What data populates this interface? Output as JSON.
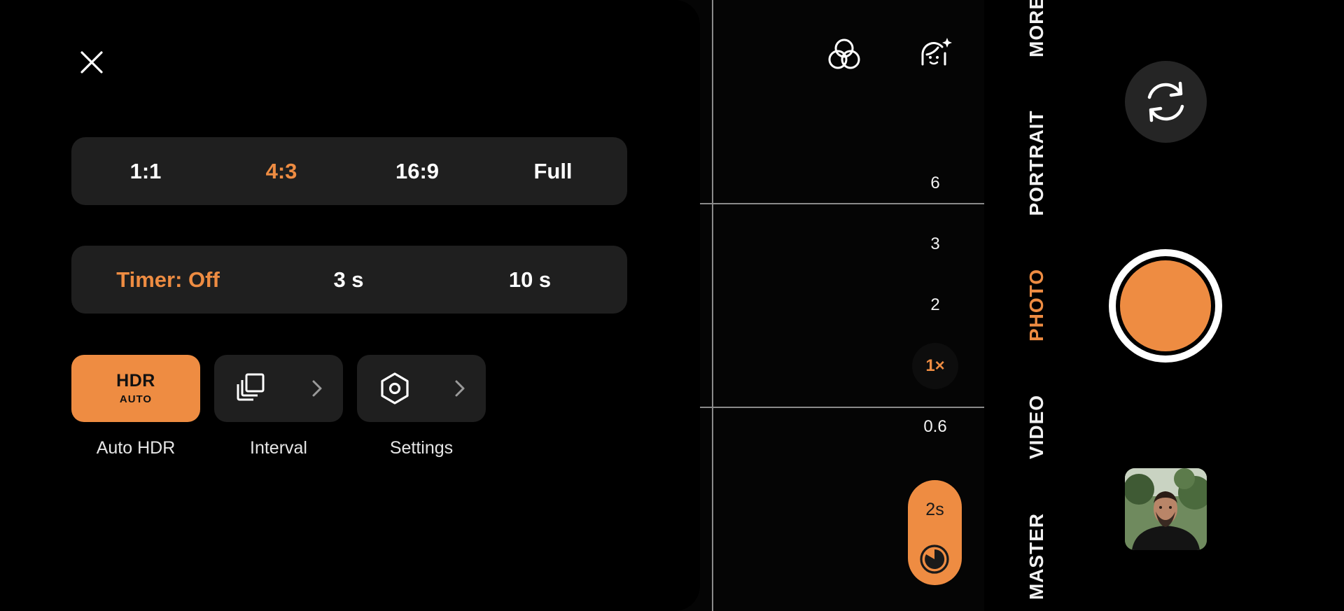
{
  "colors": {
    "accent": "#ee8c42",
    "panel_bg": "#1f1f1f",
    "text": "#ffffff"
  },
  "aspect_ratio": {
    "options": [
      {
        "label": "1:1",
        "active": false
      },
      {
        "label": "4:3",
        "active": true
      },
      {
        "label": "16:9",
        "active": false
      },
      {
        "label": "Full",
        "active": false
      }
    ]
  },
  "timer": {
    "options": [
      {
        "label": "Timer: Off",
        "active": true
      },
      {
        "label": "3 s",
        "active": false
      },
      {
        "label": "10 s",
        "active": false
      }
    ]
  },
  "quick_buttons": [
    {
      "label": "Auto HDR",
      "icon": "hdr-auto-icon",
      "icon_text_big": "HDR",
      "icon_text_small": "AUTO",
      "active": true
    },
    {
      "label": "Interval",
      "icon": "interval-icon",
      "active": false
    },
    {
      "label": "Settings",
      "icon": "settings-icon",
      "active": false
    }
  ],
  "top_icons": [
    {
      "icon": "filters-icon"
    },
    {
      "icon": "beauty-face-icon"
    }
  ],
  "zoom": {
    "levels": [
      {
        "label": "6",
        "active": false
      },
      {
        "label": "3",
        "active": false
      },
      {
        "label": "2",
        "active": false
      },
      {
        "label": "1×",
        "active": true
      },
      {
        "label": "0.6",
        "active": false
      }
    ]
  },
  "timer_pill": {
    "label": "2s",
    "icon": "timer-dial-icon"
  },
  "modes": [
    {
      "label": "MORE",
      "active": false
    },
    {
      "label": "PORTRAIT",
      "active": true
    },
    {
      "label": "PHOTO",
      "active": true
    },
    {
      "label": "VIDEO",
      "active": false
    },
    {
      "label": "MASTER",
      "active": false
    }
  ],
  "controls": {
    "flip_icon": "camera-flip-icon",
    "shutter_icon": "shutter-button",
    "gallery_icon": "gallery-thumbnail"
  }
}
